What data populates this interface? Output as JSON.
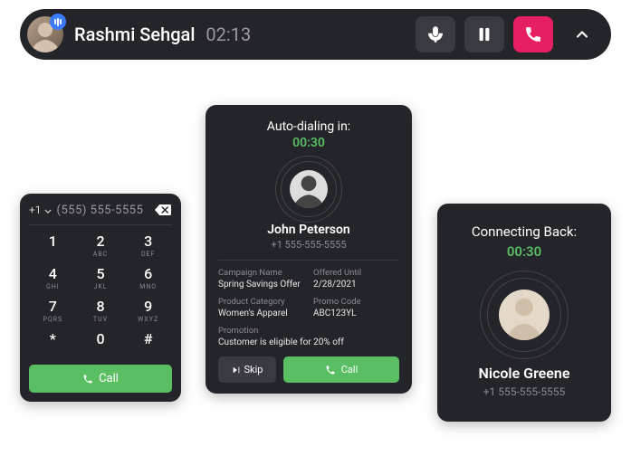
{
  "call_bar": {
    "caller_name": "Rashmi Sehgal",
    "call_duration": "02:13"
  },
  "dialpad": {
    "country_code": "+1",
    "entered_number": "(555) 555-5555",
    "keys": [
      {
        "num": "1",
        "sub": ""
      },
      {
        "num": "2",
        "sub": "ABC"
      },
      {
        "num": "3",
        "sub": "DEF"
      },
      {
        "num": "4",
        "sub": "GHI"
      },
      {
        "num": "5",
        "sub": "JKL"
      },
      {
        "num": "6",
        "sub": "MNO"
      },
      {
        "num": "7",
        "sub": "PQRS"
      },
      {
        "num": "8",
        "sub": "TUV"
      },
      {
        "num": "9",
        "sub": "WXYZ"
      },
      {
        "num": "*",
        "sub": ""
      },
      {
        "num": "0",
        "sub": ""
      },
      {
        "num": "#",
        "sub": ""
      }
    ],
    "call_label": "Call"
  },
  "autodial": {
    "title": "Auto-dialing in:",
    "timer": "00:30",
    "name": "John Peterson",
    "phone": "+1 555-555-5555",
    "fields": {
      "campaign_name_label": "Campaign Name",
      "campaign_name": "Spring Savings Offer",
      "offered_until_label": "Offered Until",
      "offered_until": "2/28/2021",
      "product_category_label": "Product Category",
      "product_category": "Women's Apparel",
      "promo_code_label": "Promo Code",
      "promo_code": "ABC123YL",
      "promotion_label": "Promotion",
      "promotion": "Customer is eligible for 20% off"
    },
    "skip_label": "Skip",
    "call_label": "Call"
  },
  "connecting": {
    "title": "Connecting Back:",
    "timer": "00:30",
    "name": "Nicole Greene",
    "phone": "+1 555-555-5555"
  }
}
